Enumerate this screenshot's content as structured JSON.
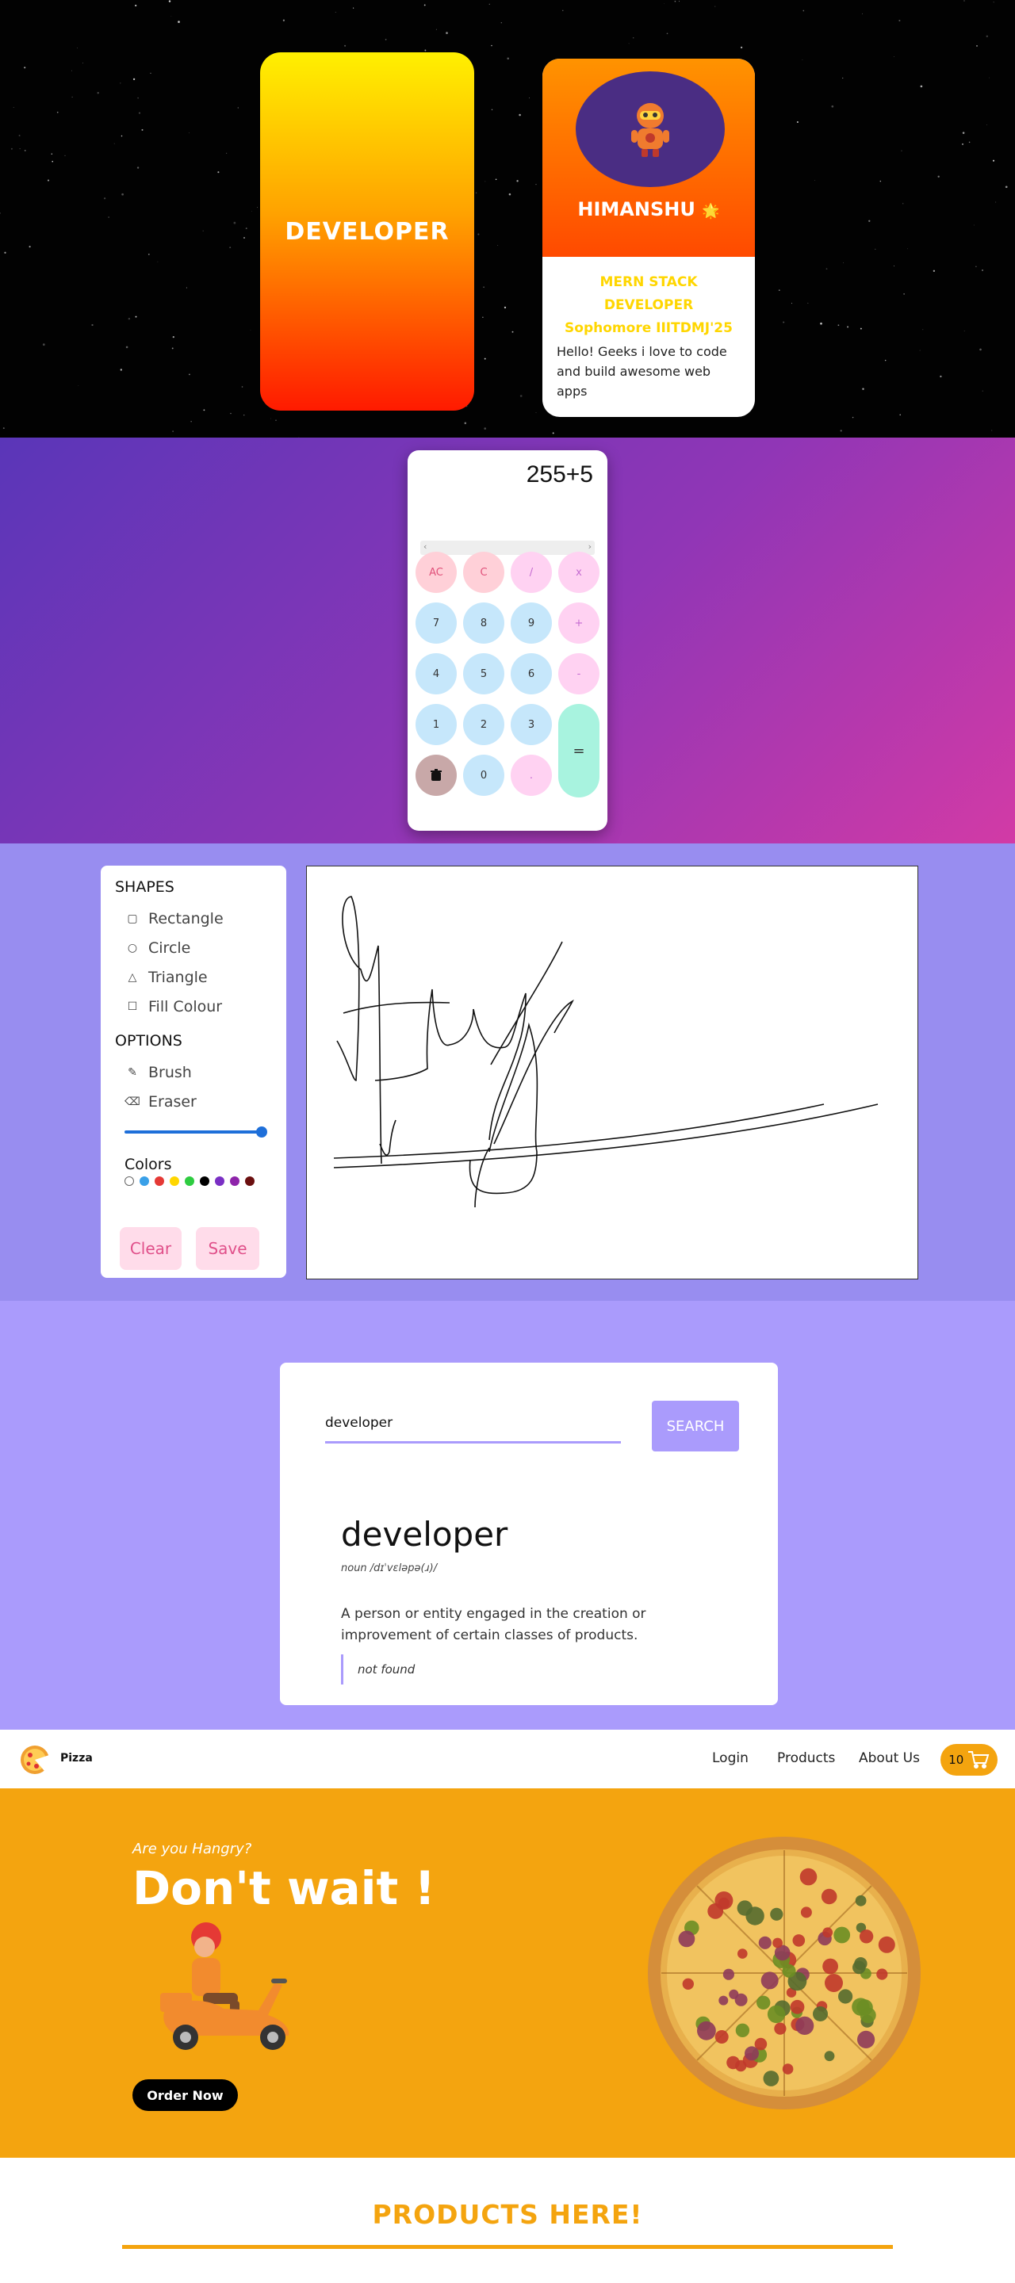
{
  "profile_card": {
    "front_title": "DEVELOPER",
    "name": "HIMANSHU",
    "name_emoji": "🌟",
    "role_line1": "MERN STACK DEVELOPER",
    "role_line2": "Sophomore IIITDMJ'25",
    "bio": "Hello! Geeks i love to code and build awesome web apps",
    "avatar_icon": "robot-icon"
  },
  "calculator": {
    "display": "255+5",
    "keys": {
      "ac": "AC",
      "c": "C",
      "divide": "/",
      "multiply": "x",
      "seven": "7",
      "eight": "8",
      "nine": "9",
      "plus": "+",
      "four": "4",
      "five": "5",
      "six": "6",
      "minus": "-",
      "one": "1",
      "two": "2",
      "three": "3",
      "equals": "=",
      "zero": "0",
      "dot": "."
    },
    "delete_icon": "trash-icon"
  },
  "drawing": {
    "shapes_heading": "SHAPES",
    "shapes": [
      "Rectangle",
      "Circle",
      "Triangle",
      "Fill Colour"
    ],
    "options_heading": "OPTIONS",
    "options": [
      "Brush",
      "Eraser"
    ],
    "size_fraction": 1.0,
    "colors_heading": "Colors",
    "colors": [
      "#ffffff",
      "#3aa0e8",
      "#e53935",
      "#ffd600",
      "#2ecc40",
      "#000000",
      "#7a2fc4",
      "#8e24aa",
      "#6b0f0f"
    ],
    "clear_label": "Clear",
    "save_label": "Save"
  },
  "dictionary": {
    "input_value": "developer",
    "search_label": "SEARCH",
    "word": "developer",
    "phonetic": "noun /dɪˈvɛləpə(ɹ)/",
    "definition": "A person or entity engaged in the creation or improvement of certain classes of products.",
    "example": "not found"
  },
  "pizza": {
    "brand": "Pizza",
    "nav": [
      "Login",
      "Products",
      "About Us"
    ],
    "cart_count": "10",
    "hero_subtitle": "Are you Hangry?",
    "hero_title": "Don't wait !",
    "order_label": "Order Now",
    "products_heading": "PRODUCTS HERE!"
  },
  "colors": {
    "card_gradient": [
      "#fff000",
      "#ff1a00"
    ],
    "calc_bg": [
      "#5a36b8",
      "#d23aa6"
    ],
    "drawing_bg": "#988df0",
    "dict_bg": "#aa9bfc",
    "pizza_orange": "#f4a40f"
  }
}
